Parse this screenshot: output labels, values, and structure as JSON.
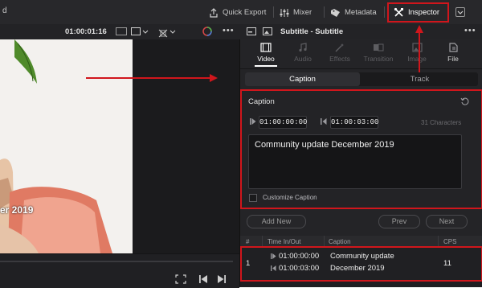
{
  "topbar": {
    "left_fragment": "d",
    "quick_export": "Quick Export",
    "mixer": "Mixer",
    "metadata": "Metadata",
    "inspector": "Inspector"
  },
  "viewer": {
    "timecode": "01:00:01:16",
    "overlay_text": "er 2019"
  },
  "inspector": {
    "title": "Subtitle - Subtitle",
    "tabs": [
      {
        "label": "Video",
        "icon": "film-icon",
        "active": true
      },
      {
        "label": "Audio",
        "icon": "music-note-icon",
        "active": false
      },
      {
        "label": "Effects",
        "icon": "magic-wand-icon",
        "active": false
      },
      {
        "label": "Transition",
        "icon": "transition-icon",
        "active": false
      },
      {
        "label": "Image",
        "icon": "image-icon",
        "active": false
      },
      {
        "label": "File",
        "icon": "file-icon",
        "active": false
      }
    ],
    "subtabs": {
      "caption": "Caption",
      "track": "Track"
    },
    "caption_section": {
      "title": "Caption",
      "in_time": "01:00:00:00",
      "out_time": "01:00:03:00",
      "characters": "31 Characters",
      "text": "Community update December 2019",
      "customize_label": "Customize Caption"
    },
    "buttons": {
      "add_new": "Add New",
      "prev": "Prev",
      "next": "Next"
    },
    "table": {
      "headers": [
        "#",
        "Time In/Out",
        "Caption",
        "CPS"
      ],
      "rows": [
        {
          "num": "1",
          "time_in": "01:00:00:00",
          "time_out": "01:00:03:00",
          "caption_line1": "Community update",
          "caption_line2": "December 2019",
          "cps": "11"
        }
      ]
    }
  },
  "colors": {
    "annotation_red": "#d0161c",
    "panel_bg": "#242427",
    "active_tab": "#ffffff"
  }
}
